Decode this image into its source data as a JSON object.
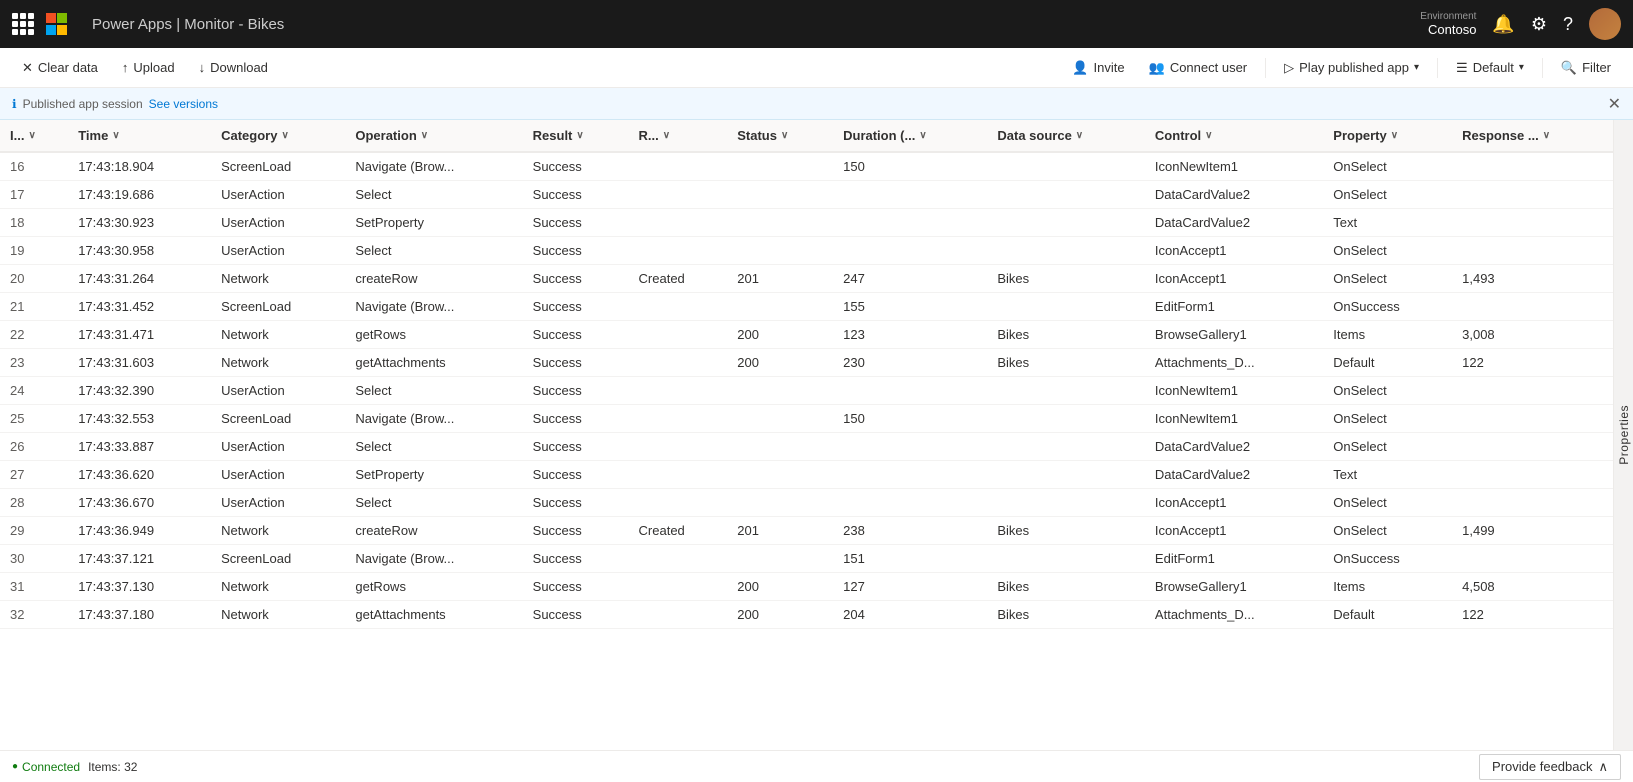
{
  "app": {
    "title": "Power Apps | Monitor - Bikes",
    "ms_label": "Microsoft"
  },
  "nav": {
    "environment_label": "Environment",
    "environment_name": "Contoso"
  },
  "toolbar": {
    "clear_data": "Clear data",
    "upload": "Upload",
    "download": "Download",
    "invite": "Invite",
    "connect_user": "Connect user",
    "play_published_app": "Play published app",
    "default": "Default",
    "filter": "Filter"
  },
  "info_bar": {
    "text": "Published app session",
    "link": "See versions"
  },
  "columns": [
    {
      "key": "id",
      "label": "I..."
    },
    {
      "key": "time",
      "label": "Time"
    },
    {
      "key": "category",
      "label": "Category"
    },
    {
      "key": "operation",
      "label": "Operation"
    },
    {
      "key": "result",
      "label": "Result"
    },
    {
      "key": "r",
      "label": "R..."
    },
    {
      "key": "status",
      "label": "Status"
    },
    {
      "key": "duration",
      "label": "Duration (..."
    },
    {
      "key": "data_source",
      "label": "Data source"
    },
    {
      "key": "control",
      "label": "Control"
    },
    {
      "key": "property",
      "label": "Property"
    },
    {
      "key": "response",
      "label": "Response ..."
    }
  ],
  "rows": [
    {
      "id": 16,
      "time": "17:43:18.904",
      "category": "ScreenLoad",
      "operation": "Navigate (Brow...",
      "result": "Success",
      "r": "",
      "status": "",
      "duration": "150",
      "data_source": "",
      "control": "IconNewItem1",
      "property": "OnSelect",
      "response": ""
    },
    {
      "id": 17,
      "time": "17:43:19.686",
      "category": "UserAction",
      "operation": "Select",
      "result": "Success",
      "r": "",
      "status": "",
      "duration": "",
      "data_source": "",
      "control": "DataCardValue2",
      "property": "OnSelect",
      "response": ""
    },
    {
      "id": 18,
      "time": "17:43:30.923",
      "category": "UserAction",
      "operation": "SetProperty",
      "result": "Success",
      "r": "",
      "status": "",
      "duration": "",
      "data_source": "",
      "control": "DataCardValue2",
      "property": "Text",
      "response": ""
    },
    {
      "id": 19,
      "time": "17:43:30.958",
      "category": "UserAction",
      "operation": "Select",
      "result": "Success",
      "r": "",
      "status": "",
      "duration": "",
      "data_source": "",
      "control": "IconAccept1",
      "property": "OnSelect",
      "response": ""
    },
    {
      "id": 20,
      "time": "17:43:31.264",
      "category": "Network",
      "operation": "createRow",
      "result": "Success",
      "r": "Created",
      "status": "201",
      "duration": "247",
      "data_source": "Bikes",
      "control": "IconAccept1",
      "property": "OnSelect",
      "response": "1,493"
    },
    {
      "id": 21,
      "time": "17:43:31.452",
      "category": "ScreenLoad",
      "operation": "Navigate (Brow...",
      "result": "Success",
      "r": "",
      "status": "",
      "duration": "155",
      "data_source": "",
      "control": "EditForm1",
      "property": "OnSuccess",
      "response": ""
    },
    {
      "id": 22,
      "time": "17:43:31.471",
      "category": "Network",
      "operation": "getRows",
      "result": "Success",
      "r": "",
      "status": "200",
      "duration": "123",
      "data_source": "Bikes",
      "control": "BrowseGallery1",
      "property": "Items",
      "response": "3,008"
    },
    {
      "id": 23,
      "time": "17:43:31.603",
      "category": "Network",
      "operation": "getAttachments",
      "result": "Success",
      "r": "",
      "status": "200",
      "duration": "230",
      "data_source": "Bikes",
      "control": "Attachments_D...",
      "property": "Default",
      "response": "122"
    },
    {
      "id": 24,
      "time": "17:43:32.390",
      "category": "UserAction",
      "operation": "Select",
      "result": "Success",
      "r": "",
      "status": "",
      "duration": "",
      "data_source": "",
      "control": "IconNewItem1",
      "property": "OnSelect",
      "response": ""
    },
    {
      "id": 25,
      "time": "17:43:32.553",
      "category": "ScreenLoad",
      "operation": "Navigate (Brow...",
      "result": "Success",
      "r": "",
      "status": "",
      "duration": "150",
      "data_source": "",
      "control": "IconNewItem1",
      "property": "OnSelect",
      "response": ""
    },
    {
      "id": 26,
      "time": "17:43:33.887",
      "category": "UserAction",
      "operation": "Select",
      "result": "Success",
      "r": "",
      "status": "",
      "duration": "",
      "data_source": "",
      "control": "DataCardValue2",
      "property": "OnSelect",
      "response": ""
    },
    {
      "id": 27,
      "time": "17:43:36.620",
      "category": "UserAction",
      "operation": "SetProperty",
      "result": "Success",
      "r": "",
      "status": "",
      "duration": "",
      "data_source": "",
      "control": "DataCardValue2",
      "property": "Text",
      "response": ""
    },
    {
      "id": 28,
      "time": "17:43:36.670",
      "category": "UserAction",
      "operation": "Select",
      "result": "Success",
      "r": "",
      "status": "",
      "duration": "",
      "data_source": "",
      "control": "IconAccept1",
      "property": "OnSelect",
      "response": ""
    },
    {
      "id": 29,
      "time": "17:43:36.949",
      "category": "Network",
      "operation": "createRow",
      "result": "Success",
      "r": "Created",
      "status": "201",
      "duration": "238",
      "data_source": "Bikes",
      "control": "IconAccept1",
      "property": "OnSelect",
      "response": "1,499"
    },
    {
      "id": 30,
      "time": "17:43:37.121",
      "category": "ScreenLoad",
      "operation": "Navigate (Brow...",
      "result": "Success",
      "r": "",
      "status": "",
      "duration": "151",
      "data_source": "",
      "control": "EditForm1",
      "property": "OnSuccess",
      "response": ""
    },
    {
      "id": 31,
      "time": "17:43:37.130",
      "category": "Network",
      "operation": "getRows",
      "result": "Success",
      "r": "",
      "status": "200",
      "duration": "127",
      "data_source": "Bikes",
      "control": "BrowseGallery1",
      "property": "Items",
      "response": "4,508"
    },
    {
      "id": 32,
      "time": "17:43:37.180",
      "category": "Network",
      "operation": "getAttachments",
      "result": "Success",
      "r": "",
      "status": "200",
      "duration": "204",
      "data_source": "Bikes",
      "control": "Attachments_D...",
      "property": "Default",
      "response": "122"
    }
  ],
  "properties_panel": {
    "label": "Properties"
  },
  "status_bar": {
    "connected": "Connected",
    "items": "Items: 32"
  },
  "feedback": {
    "label": "Provide feedback"
  }
}
